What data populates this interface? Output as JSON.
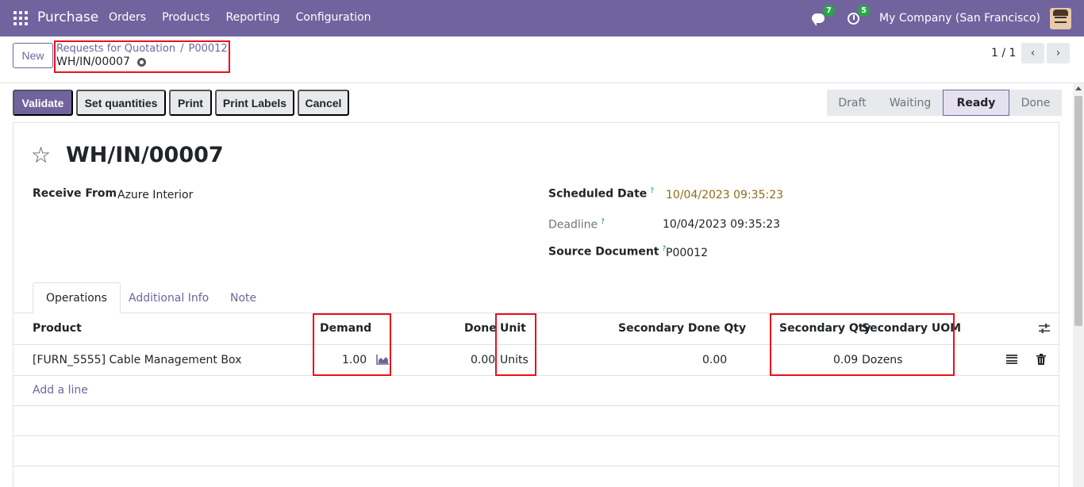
{
  "navbar": {
    "app_name": "Purchase",
    "menu": [
      "Orders",
      "Products",
      "Reporting",
      "Configuration"
    ],
    "messages_count": "7",
    "activities_count": "5",
    "company": "My Company (San Francisco)"
  },
  "control_panel": {
    "new_label": "New",
    "breadcrumb_parent": "Requests for Quotation",
    "breadcrumb_separator": "/",
    "breadcrumb_order": "P00012",
    "current_record": "WH/IN/00007",
    "pager": "1 / 1",
    "pager_prev": "‹",
    "pager_next": "›"
  },
  "actions": {
    "validate": "Validate",
    "set_quantities": "Set quantities",
    "print": "Print",
    "print_labels": "Print Labels",
    "cancel": "Cancel"
  },
  "stages": {
    "draft": "Draft",
    "waiting": "Waiting",
    "ready": "Ready",
    "done": "Done",
    "active": "Ready"
  },
  "record": {
    "title": "WH/IN/00007",
    "receive_from_label": "Receive From",
    "receive_from": "Azure Interior",
    "scheduled_date_label": "Scheduled Date",
    "scheduled_date": "10/04/2023 09:35:23",
    "deadline_label": "Deadline",
    "deadline": "10/04/2023 09:35:23",
    "source_document_label": "Source Document",
    "source_document": "P00012",
    "help_mark": "?"
  },
  "tabs": {
    "operations": "Operations",
    "additional_info": "Additional Info",
    "note": "Note"
  },
  "table": {
    "headers": {
      "product": "Product",
      "demand": "Demand",
      "done": "Done",
      "unit": "Unit",
      "secondary_done_qty": "Secondary Done Qty",
      "secondary_qty": "Secondary Qty",
      "secondary_uom": "Secondary UOM"
    },
    "rows": [
      {
        "product": "[FURN_5555] Cable Management Box",
        "demand": "1.00",
        "done": "0.00",
        "unit": "Units",
        "secondary_done_qty": "0.00",
        "secondary_qty": "0.09",
        "secondary_uom": "Dozens"
      }
    ],
    "add_line": "Add a line"
  },
  "colors": {
    "brand": "#71639e",
    "highlight": "#e8121a",
    "badge": "#28a745",
    "warning_date": "#8f6a17"
  }
}
